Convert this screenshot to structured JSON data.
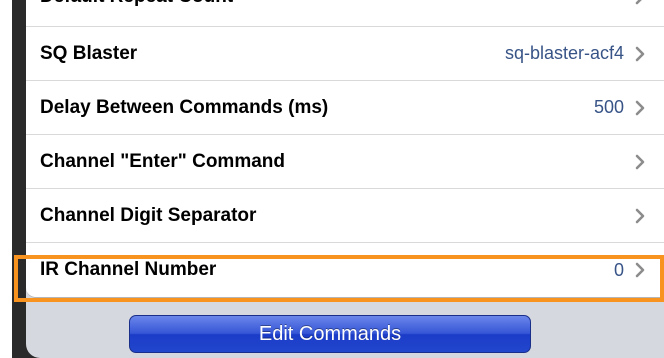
{
  "settings": {
    "rows": [
      {
        "label": "Default Repeat Count",
        "value": ""
      },
      {
        "label": "SQ Blaster",
        "value": "sq-blaster-acf4"
      },
      {
        "label": "Delay Between Commands (ms)",
        "value": "500"
      },
      {
        "label": "Channel \"Enter\" Command",
        "value": ""
      },
      {
        "label": "Channel Digit Separator",
        "value": ""
      },
      {
        "label": "IR Channel Number",
        "value": "0"
      }
    ]
  },
  "edit_commands_label": "Edit Commands",
  "colors": {
    "highlight": "#f7931e",
    "value_text": "#385487",
    "button_blue": "#2246cc"
  },
  "icons": {
    "row_disclosure": "chevron-right-icon"
  }
}
